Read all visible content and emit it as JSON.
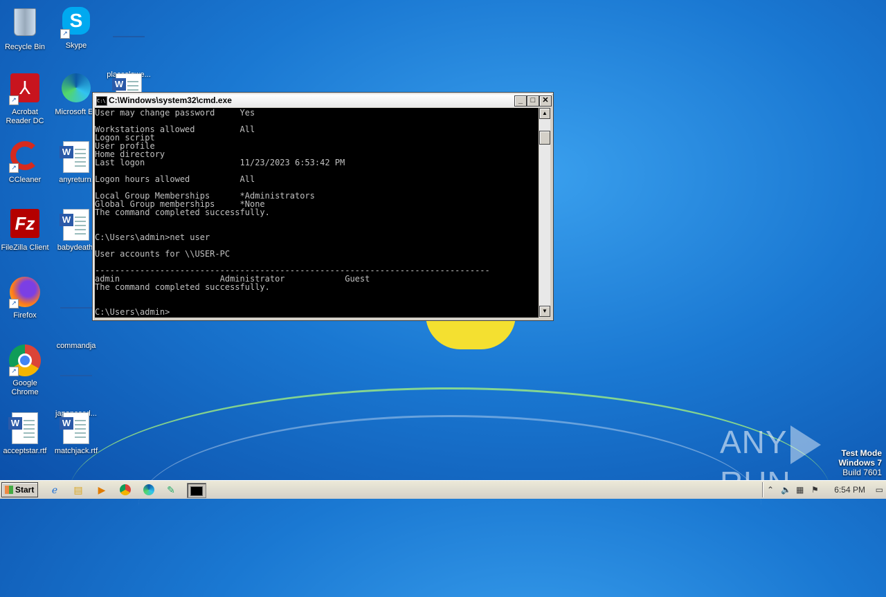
{
  "desktop": {
    "icons": [
      {
        "label": "Recycle Bin",
        "icon": "recycle-bin-icon"
      },
      {
        "label": "Skype",
        "icon": "skype-icon"
      },
      {
        "label": "placeslowe...",
        "icon": "blank-file-icon"
      },
      {
        "label": "Acrobat Reader DC",
        "icon": "acrobat-icon"
      },
      {
        "label": "Microsoft Ed",
        "icon": "edge-icon"
      },
      {
        "label": "CCleaner",
        "icon": "ccleaner-icon"
      },
      {
        "label": "anyreturn.",
        "icon": "word-doc-icon"
      },
      {
        "label": "FileZilla Client",
        "icon": "filezilla-icon"
      },
      {
        "label": "babydeath.",
        "icon": "word-doc-icon"
      },
      {
        "label": "Firefox",
        "icon": "firefox-icon"
      },
      {
        "label": "commandja",
        "icon": "blank-file-icon"
      },
      {
        "label": "Google Chrome",
        "icon": "chrome-icon"
      },
      {
        "label": "japanesed...",
        "icon": "blank-file-icon"
      },
      {
        "label": "acceptstar.rtf",
        "icon": "word-doc-icon"
      },
      {
        "label": "matchjack.rtf",
        "icon": "word-doc-icon"
      }
    ]
  },
  "cmd_window": {
    "title": "C:\\Windows\\system32\\cmd.exe",
    "lines": [
      "User may change password     Yes",
      "",
      "Workstations allowed         All",
      "Logon script",
      "User profile",
      "Home directory",
      "Last logon                   11/23/2023 6:53:42 PM",
      "",
      "Logon hours allowed          All",
      "",
      "Local Group Memberships      *Administrators",
      "Global Group memberships     *None",
      "The command completed successfully.",
      "",
      "",
      "C:\\Users\\admin>net user",
      "",
      "User accounts for \\\\USER-PC",
      "",
      "-------------------------------------------------------------------------------",
      "admin                    Administrator            Guest",
      "The command completed successfully.",
      "",
      "",
      "C:\\Users\\admin>"
    ]
  },
  "watermark": {
    "brand_left": "ANY",
    "brand_right": "RUN",
    "test_mode": "Test Mode",
    "os": "Windows 7",
    "build": "Build 7601"
  },
  "taskbar": {
    "start_label": "Start",
    "clock": "6:54 PM",
    "pinned": [
      "ie-icon",
      "explorer-icon",
      "media-player-icon",
      "chrome-icon",
      "edge-icon",
      "screenshot-icon",
      "cmd-icon"
    ]
  },
  "colors": {
    "console_bg": "#000000",
    "console_fg": "#c0c0c0",
    "desktop_blue": "#1a78d2"
  }
}
